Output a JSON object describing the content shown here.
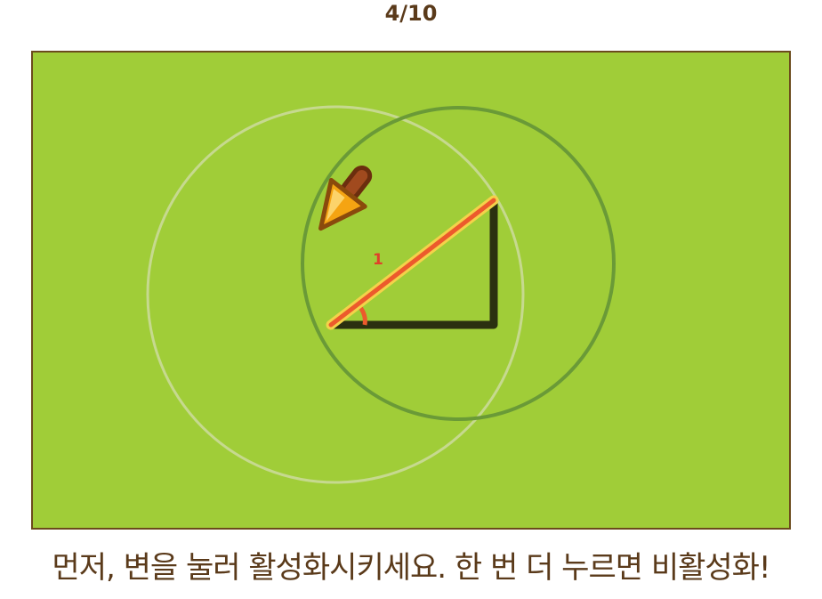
{
  "progress": "4/10",
  "instruction": "먼저, 변을 눌러 활성화시키세요. 한 번 더 누르면 비활성화!",
  "angle_label": "1",
  "colors": {
    "board_bg": "#a0cd38",
    "board_border": "#6b4a1c",
    "circle_light": "#c6d98f",
    "circle_dark": "#6a9a37",
    "triangle_stroke": "#2b3010",
    "hypotenuse_outer": "#f4d24a",
    "hypotenuse_inner": "#ec5a2c",
    "angle_arc": "#ec5a2c",
    "label": "#e0402a",
    "text": "#5a3a1a"
  },
  "icons": [
    "arrow-pointer-icon"
  ]
}
